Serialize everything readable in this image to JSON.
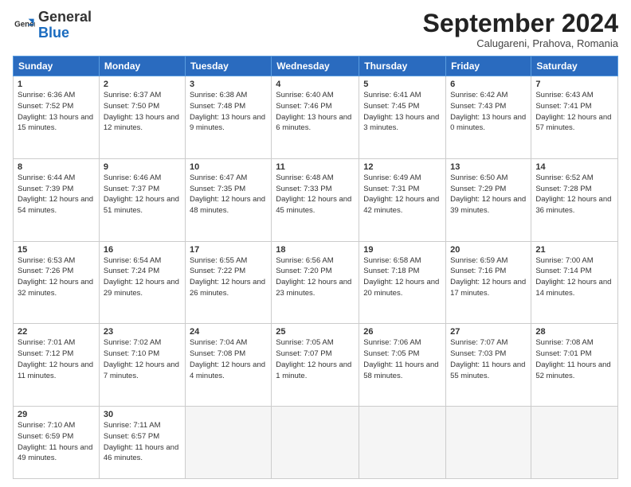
{
  "header": {
    "logo_general": "General",
    "logo_blue": "Blue",
    "title": "September 2024",
    "location": "Calugareni, Prahova, Romania"
  },
  "weekdays": [
    "Sunday",
    "Monday",
    "Tuesday",
    "Wednesday",
    "Thursday",
    "Friday",
    "Saturday"
  ],
  "weeks": [
    [
      {
        "day": "1",
        "sunrise": "Sunrise: 6:36 AM",
        "sunset": "Sunset: 7:52 PM",
        "daylight": "Daylight: 13 hours and 15 minutes."
      },
      {
        "day": "2",
        "sunrise": "Sunrise: 6:37 AM",
        "sunset": "Sunset: 7:50 PM",
        "daylight": "Daylight: 13 hours and 12 minutes."
      },
      {
        "day": "3",
        "sunrise": "Sunrise: 6:38 AM",
        "sunset": "Sunset: 7:48 PM",
        "daylight": "Daylight: 13 hours and 9 minutes."
      },
      {
        "day": "4",
        "sunrise": "Sunrise: 6:40 AM",
        "sunset": "Sunset: 7:46 PM",
        "daylight": "Daylight: 13 hours and 6 minutes."
      },
      {
        "day": "5",
        "sunrise": "Sunrise: 6:41 AM",
        "sunset": "Sunset: 7:45 PM",
        "daylight": "Daylight: 13 hours and 3 minutes."
      },
      {
        "day": "6",
        "sunrise": "Sunrise: 6:42 AM",
        "sunset": "Sunset: 7:43 PM",
        "daylight": "Daylight: 13 hours and 0 minutes."
      },
      {
        "day": "7",
        "sunrise": "Sunrise: 6:43 AM",
        "sunset": "Sunset: 7:41 PM",
        "daylight": "Daylight: 12 hours and 57 minutes."
      }
    ],
    [
      {
        "day": "8",
        "sunrise": "Sunrise: 6:44 AM",
        "sunset": "Sunset: 7:39 PM",
        "daylight": "Daylight: 12 hours and 54 minutes."
      },
      {
        "day": "9",
        "sunrise": "Sunrise: 6:46 AM",
        "sunset": "Sunset: 7:37 PM",
        "daylight": "Daylight: 12 hours and 51 minutes."
      },
      {
        "day": "10",
        "sunrise": "Sunrise: 6:47 AM",
        "sunset": "Sunset: 7:35 PM",
        "daylight": "Daylight: 12 hours and 48 minutes."
      },
      {
        "day": "11",
        "sunrise": "Sunrise: 6:48 AM",
        "sunset": "Sunset: 7:33 PM",
        "daylight": "Daylight: 12 hours and 45 minutes."
      },
      {
        "day": "12",
        "sunrise": "Sunrise: 6:49 AM",
        "sunset": "Sunset: 7:31 PM",
        "daylight": "Daylight: 12 hours and 42 minutes."
      },
      {
        "day": "13",
        "sunrise": "Sunrise: 6:50 AM",
        "sunset": "Sunset: 7:29 PM",
        "daylight": "Daylight: 12 hours and 39 minutes."
      },
      {
        "day": "14",
        "sunrise": "Sunrise: 6:52 AM",
        "sunset": "Sunset: 7:28 PM",
        "daylight": "Daylight: 12 hours and 36 minutes."
      }
    ],
    [
      {
        "day": "15",
        "sunrise": "Sunrise: 6:53 AM",
        "sunset": "Sunset: 7:26 PM",
        "daylight": "Daylight: 12 hours and 32 minutes."
      },
      {
        "day": "16",
        "sunrise": "Sunrise: 6:54 AM",
        "sunset": "Sunset: 7:24 PM",
        "daylight": "Daylight: 12 hours and 29 minutes."
      },
      {
        "day": "17",
        "sunrise": "Sunrise: 6:55 AM",
        "sunset": "Sunset: 7:22 PM",
        "daylight": "Daylight: 12 hours and 26 minutes."
      },
      {
        "day": "18",
        "sunrise": "Sunrise: 6:56 AM",
        "sunset": "Sunset: 7:20 PM",
        "daylight": "Daylight: 12 hours and 23 minutes."
      },
      {
        "day": "19",
        "sunrise": "Sunrise: 6:58 AM",
        "sunset": "Sunset: 7:18 PM",
        "daylight": "Daylight: 12 hours and 20 minutes."
      },
      {
        "day": "20",
        "sunrise": "Sunrise: 6:59 AM",
        "sunset": "Sunset: 7:16 PM",
        "daylight": "Daylight: 12 hours and 17 minutes."
      },
      {
        "day": "21",
        "sunrise": "Sunrise: 7:00 AM",
        "sunset": "Sunset: 7:14 PM",
        "daylight": "Daylight: 12 hours and 14 minutes."
      }
    ],
    [
      {
        "day": "22",
        "sunrise": "Sunrise: 7:01 AM",
        "sunset": "Sunset: 7:12 PM",
        "daylight": "Daylight: 12 hours and 11 minutes."
      },
      {
        "day": "23",
        "sunrise": "Sunrise: 7:02 AM",
        "sunset": "Sunset: 7:10 PM",
        "daylight": "Daylight: 12 hours and 7 minutes."
      },
      {
        "day": "24",
        "sunrise": "Sunrise: 7:04 AM",
        "sunset": "Sunset: 7:08 PM",
        "daylight": "Daylight: 12 hours and 4 minutes."
      },
      {
        "day": "25",
        "sunrise": "Sunrise: 7:05 AM",
        "sunset": "Sunset: 7:07 PM",
        "daylight": "Daylight: 12 hours and 1 minute."
      },
      {
        "day": "26",
        "sunrise": "Sunrise: 7:06 AM",
        "sunset": "Sunset: 7:05 PM",
        "daylight": "Daylight: 11 hours and 58 minutes."
      },
      {
        "day": "27",
        "sunrise": "Sunrise: 7:07 AM",
        "sunset": "Sunset: 7:03 PM",
        "daylight": "Daylight: 11 hours and 55 minutes."
      },
      {
        "day": "28",
        "sunrise": "Sunrise: 7:08 AM",
        "sunset": "Sunset: 7:01 PM",
        "daylight": "Daylight: 11 hours and 52 minutes."
      }
    ],
    [
      {
        "day": "29",
        "sunrise": "Sunrise: 7:10 AM",
        "sunset": "Sunset: 6:59 PM",
        "daylight": "Daylight: 11 hours and 49 minutes."
      },
      {
        "day": "30",
        "sunrise": "Sunrise: 7:11 AM",
        "sunset": "Sunset: 6:57 PM",
        "daylight": "Daylight: 11 hours and 46 minutes."
      },
      null,
      null,
      null,
      null,
      null
    ]
  ]
}
